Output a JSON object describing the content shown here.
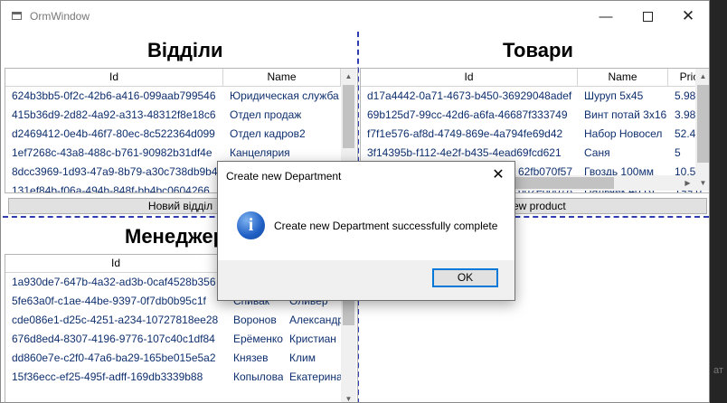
{
  "window": {
    "title": "OrmWindow",
    "minimize_glyph": "—",
    "close_glyph": "✕"
  },
  "departments": {
    "title": "Відділи",
    "columns": [
      "Id",
      "Name"
    ],
    "rows": [
      [
        "624b3bb5-0f2c-42b6-a416-099aab799546",
        "Юридическая служба"
      ],
      [
        "415b36d9-2d82-4a92-a313-48312f8e18c6",
        "Отдел продаж"
      ],
      [
        "d2469412-0e4b-46f7-80ec-8c522364d099",
        "Отдел кадров2"
      ],
      [
        "1ef7268c-43a8-488c-b761-90982b31df4e",
        "Канцелярия"
      ],
      [
        "8dcc3969-1d93-47a9-8b79-a30c738db9b4",
        ""
      ],
      [
        "131ef84b-f06a-494b-848f-bb4bc0604266",
        ""
      ]
    ],
    "button": "Новий відділ"
  },
  "products": {
    "title": "Товари",
    "columns": [
      "Id",
      "Name",
      "Pric"
    ],
    "rows": [
      [
        "d17a4442-0a71-4673-b450-36929048adef",
        "Шуруп 5х45",
        "5.98"
      ],
      [
        "69b125d7-99cc-42d6-a6fa-46687f333749",
        "Винт потай 3х16",
        "3.98"
      ],
      [
        "f7f1e576-af8d-4749-869e-4a794fe69d42",
        "Набор Новосел",
        "52.4"
      ],
      [
        "3f14395b-f112-4e2f-b435-4ead69fcd621",
        "Саня",
        "5"
      ],
      [
        "",
        "Гвоздь 100мм",
        "10.5"
      ],
      [
        "",
        "Пальчик 40 Вт",
        "199.0"
      ]
    ],
    "row5_id_tail": "62fb070f57",
    "row6_id_tail": "6d2e60078",
    "button": "New product"
  },
  "managers": {
    "title": "Менеджери",
    "columns": [
      "Id",
      "",
      ""
    ],
    "rows": [
      [
        "1a930de7-647b-4a32-ad3b-0caf4528b356",
        "",
        ""
      ],
      [
        "5fe63a0f-c1ae-44be-9397-0f7db0b95c1f",
        "Спивак",
        "Оливер"
      ],
      [
        "cde086e1-d25c-4251-a234-10727818ee28",
        "Воронов",
        "Александр"
      ],
      [
        "676d8ed4-8307-4196-9776-107c40c1df84",
        "Ерёменко",
        "Кристиан"
      ],
      [
        "dd860e7e-c2f0-47a6-ba29-165be015e5a2",
        "Князев",
        "Клим"
      ],
      [
        "15f36ecc-ef25-495f-adff-169db3339b88",
        "Копылова",
        "Екатерина"
      ]
    ]
  },
  "dialog": {
    "title": "Create new Department",
    "message": "Create new Department successfully complete",
    "ok_label": "OK",
    "icon": "information-icon"
  },
  "scroll_arrows": {
    "up": "▲",
    "down": "▼",
    "left": "◀",
    "right": "▶"
  },
  "edge_text": "ат"
}
